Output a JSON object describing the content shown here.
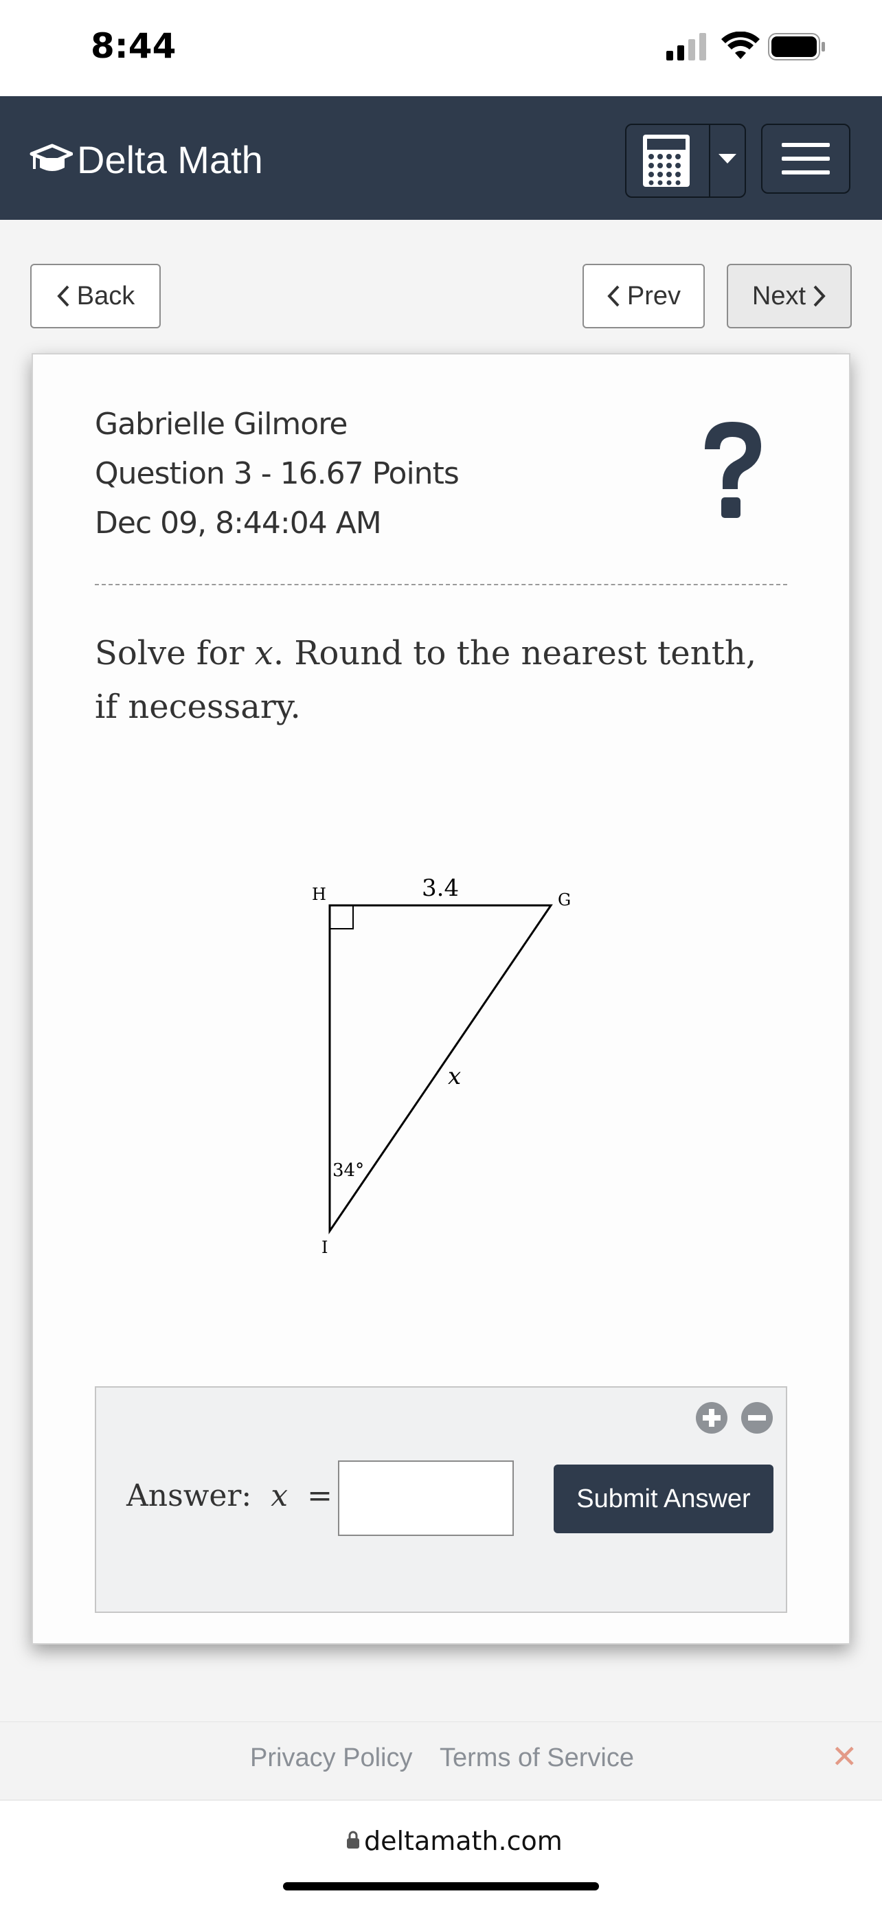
{
  "status_bar": {
    "time": "8:44"
  },
  "header": {
    "brand": "Delta Math"
  },
  "nav": {
    "back_label": "Back",
    "prev_label": "Prev",
    "next_label": "Next"
  },
  "question": {
    "student_name": "Gabrielle Gilmore",
    "info": "Question 3 - 16.67 Points",
    "datetime": "Dec 09, 8:44:04 AM",
    "help_symbol": "?",
    "prompt_pre": "Solve for ",
    "prompt_var": "x",
    "prompt_post": ". Round to the nearest tenth, if necessary."
  },
  "diagram": {
    "vertex_h": "H",
    "vertex_g": "G",
    "vertex_i": "I",
    "side_hg": "3.4",
    "side_ig": "x",
    "angle_i": "34°"
  },
  "answer": {
    "label_prefix": "Answer:",
    "label_var": "x",
    "label_eq": "=",
    "input_value": "",
    "submit_label": "Submit Answer"
  },
  "footer": {
    "privacy": "Privacy Policy",
    "terms": "Terms of Service",
    "close": "✕"
  },
  "browser": {
    "url": "deltamath.com"
  },
  "colors": {
    "header_bg": "#2f3b4c",
    "submit_bg": "#2f3b4c",
    "close_x": "#e39a87"
  }
}
